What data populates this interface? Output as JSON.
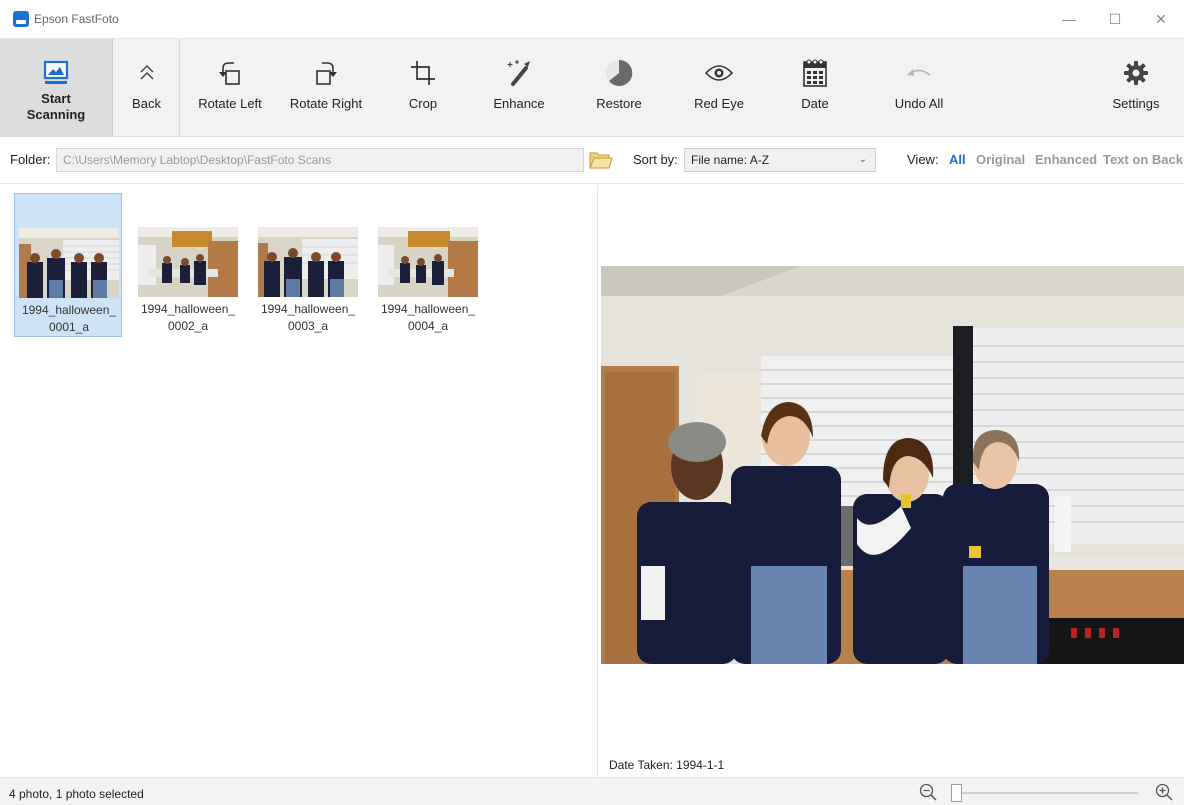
{
  "window": {
    "title": "Epson FastFoto",
    "minimize": "—",
    "maximize": "☐",
    "close": "✕"
  },
  "toolbar": {
    "start": "Start\nScanning",
    "back": "Back",
    "rotate_left": "Rotate Left",
    "rotate_right": "Rotate Right",
    "crop": "Crop",
    "enhance": "Enhance",
    "restore": "Restore",
    "red_eye": "Red Eye",
    "date": "Date",
    "undo_all": "Undo All",
    "settings": "Settings"
  },
  "folder": {
    "label": "Folder:",
    "path": "C:\\Users\\Memory Labtop\\Desktop\\FastFoto Scans"
  },
  "sort": {
    "label": "Sort by:",
    "selected": "File name: A-Z",
    "chevron": "⌄"
  },
  "view": {
    "label": "View:",
    "options": [
      "All",
      "Original",
      "Enhanced",
      "Text on Back"
    ],
    "active": "All"
  },
  "thumbnails": [
    {
      "name": "1994_halloween_\n0001_a",
      "selected": true
    },
    {
      "name": "1994_halloween_\n0002_a",
      "selected": false
    },
    {
      "name": "1994_halloween_\n0003_a",
      "selected": false
    },
    {
      "name": "1994_halloween_\n0004_a",
      "selected": false
    }
  ],
  "preview": {
    "date_taken": "Date Taken: 1994-1-1"
  },
  "status": {
    "text": "4 photo, 1 photo selected",
    "zoom_level": 0
  },
  "colors": {
    "accent": "#1c6fd1",
    "selection": "#cfe3f8",
    "toolbar_bg": "#f2f2f2"
  }
}
